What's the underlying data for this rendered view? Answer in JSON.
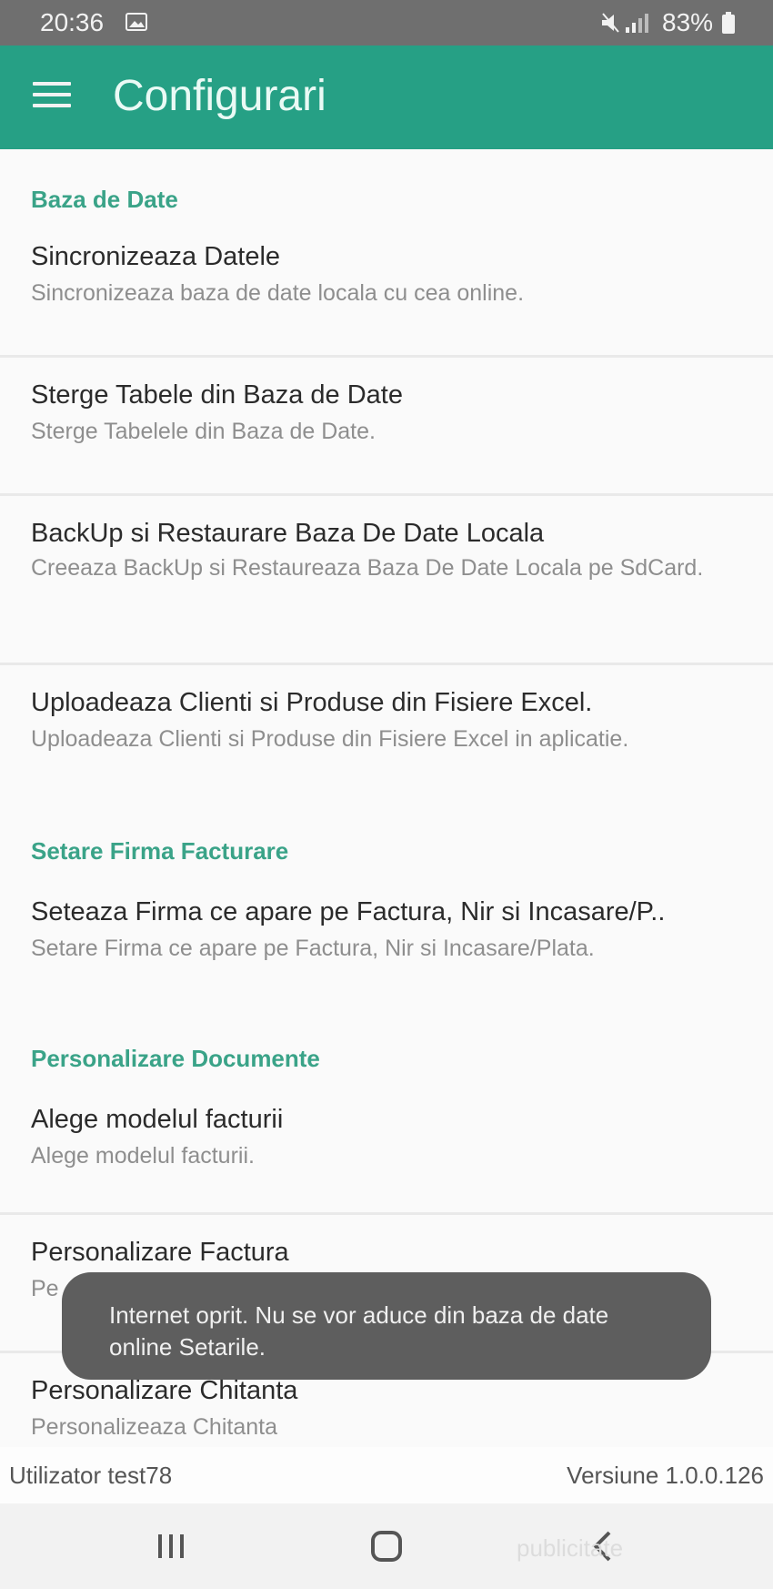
{
  "status_bar": {
    "time": "20:36",
    "battery": "83%",
    "icons": [
      "gallery-icon",
      "mute-icon",
      "signal-icon",
      "battery-icon"
    ]
  },
  "app_bar": {
    "title": "Configurari",
    "menu_icon": "hamburger-menu-icon",
    "color": "#26a085"
  },
  "sections": {
    "database": {
      "header": "Baza de Date",
      "items": [
        {
          "title": "Sincronizeaza Datele",
          "summary": "Sincronizeaza baza de date locala cu cea online."
        },
        {
          "title": "Sterge Tabele din Baza de Date",
          "summary": "Sterge Tabelele din Baza de Date."
        },
        {
          "title": "BackUp si Restaurare Baza De Date Locala",
          "summary": "Creeaza BackUp si Restaureaza Baza De Date Locala pe SdCard."
        },
        {
          "title": "Uploadeaza Clienti si Produse din Fisiere Excel.",
          "summary": "Uploadeaza Clienti si Produse din Fisiere Excel in aplicatie."
        }
      ]
    },
    "company": {
      "header": "Setare Firma Facturare",
      "items": [
        {
          "title": "Seteaza Firma ce apare pe Factura, Nir si Incasare/P..",
          "summary": "Setare Firma ce apare pe Factura, Nir si Incasare/Plata."
        }
      ]
    },
    "documents": {
      "header": "Personalizare Documente",
      "items": [
        {
          "title": "Alege modelul facturii",
          "summary": "Alege modelul facturii."
        },
        {
          "title": "Personalizare Factura",
          "summary": "Pe"
        },
        {
          "title": "Personalizare Chitanta",
          "summary": "Personalizeaza Chitanta"
        }
      ]
    }
  },
  "toast": {
    "message": "Internet oprit. Nu se vor aduce din baza de date online Setarile."
  },
  "footer": {
    "user": "Utilizator test78",
    "version": "Versiune 1.0.0.126"
  },
  "nav_bar": {
    "buttons": [
      "recent-apps-icon",
      "home-icon",
      "back-icon"
    ]
  },
  "watermark": "publicitate",
  "colors": {
    "accent": "#3aa388",
    "toast_bg": "#5e5e5e",
    "status_bar": "#6f6f6f"
  }
}
